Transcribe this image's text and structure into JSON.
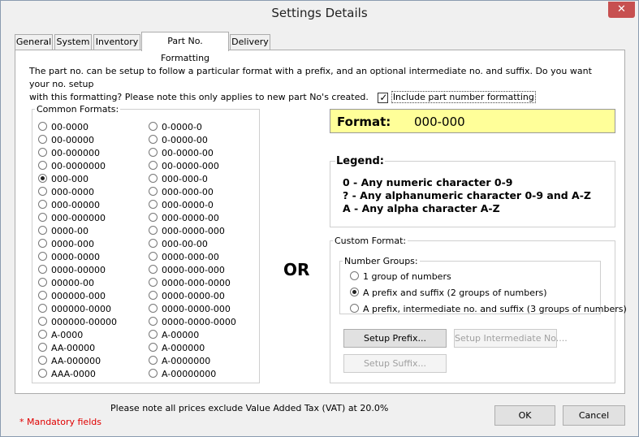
{
  "window": {
    "title": "Settings Details",
    "close_label": "✕"
  },
  "tabs": [
    "General",
    "System",
    "Inventory",
    "Part No. Formatting",
    "Delivery"
  ],
  "intro": {
    "line1": "The part no. can be setup to follow a particular format with a prefix, and an optional intermediate no. and suffix. Do you want your no. setup",
    "line2": "with this formatting? Please note this only applies to new part No's created.",
    "checkbox_label": "Include part number formatting",
    "checkbox_checked": true
  },
  "common_formats": {
    "title": "Common Formats:",
    "selected": "000-000",
    "left": [
      "00-0000",
      "00-00000",
      "00-000000",
      "00-0000000",
      "000-000",
      "000-0000",
      "000-00000",
      "000-000000",
      "0000-00",
      "0000-000",
      "0000-0000",
      "0000-00000",
      "00000-00",
      "000000-000",
      "000000-0000",
      "000000-00000",
      "A-0000",
      "AA-00000",
      "AA-000000",
      "AAA-0000"
    ],
    "right": [
      "0-0000-0",
      "0-0000-00",
      "00-0000-00",
      "00-0000-000",
      "000-000-0",
      "000-000-00",
      "000-0000-0",
      "000-0000-00",
      "000-0000-000",
      "000-00-00",
      "0000-000-00",
      "0000-000-000",
      "0000-000-0000",
      "0000-0000-00",
      "0000-0000-000",
      "0000-0000-0000",
      "A-00000",
      "A-000000",
      "A-0000000",
      "A-00000000"
    ]
  },
  "format": {
    "label": "Format:",
    "value": "000-000"
  },
  "legend": {
    "title": "Legend:",
    "lines": [
      "0 - Any numeric character 0-9",
      "? - Any alphanumeric character 0-9 and A-Z",
      "A - Any alpha character A-Z"
    ]
  },
  "or_label": "OR",
  "custom_format": {
    "title": "Custom Format:",
    "number_groups_title": "Number Groups:",
    "options": [
      "1 group of numbers",
      "A prefix and suffix (2 groups of numbers)",
      "A prefix, intermediate no. and suffix (3 groups of numbers)"
    ],
    "selected_index": 1,
    "setup_prefix": "Setup Prefix...",
    "setup_intermediate": "Setup Intermediate No....",
    "setup_suffix": "Setup Suffix..."
  },
  "footer": {
    "vat_note": "Please note all prices exclude Value Added Tax (VAT) at 20.0%",
    "mandatory": "* Mandatory fields",
    "ok": "OK",
    "cancel": "Cancel"
  }
}
